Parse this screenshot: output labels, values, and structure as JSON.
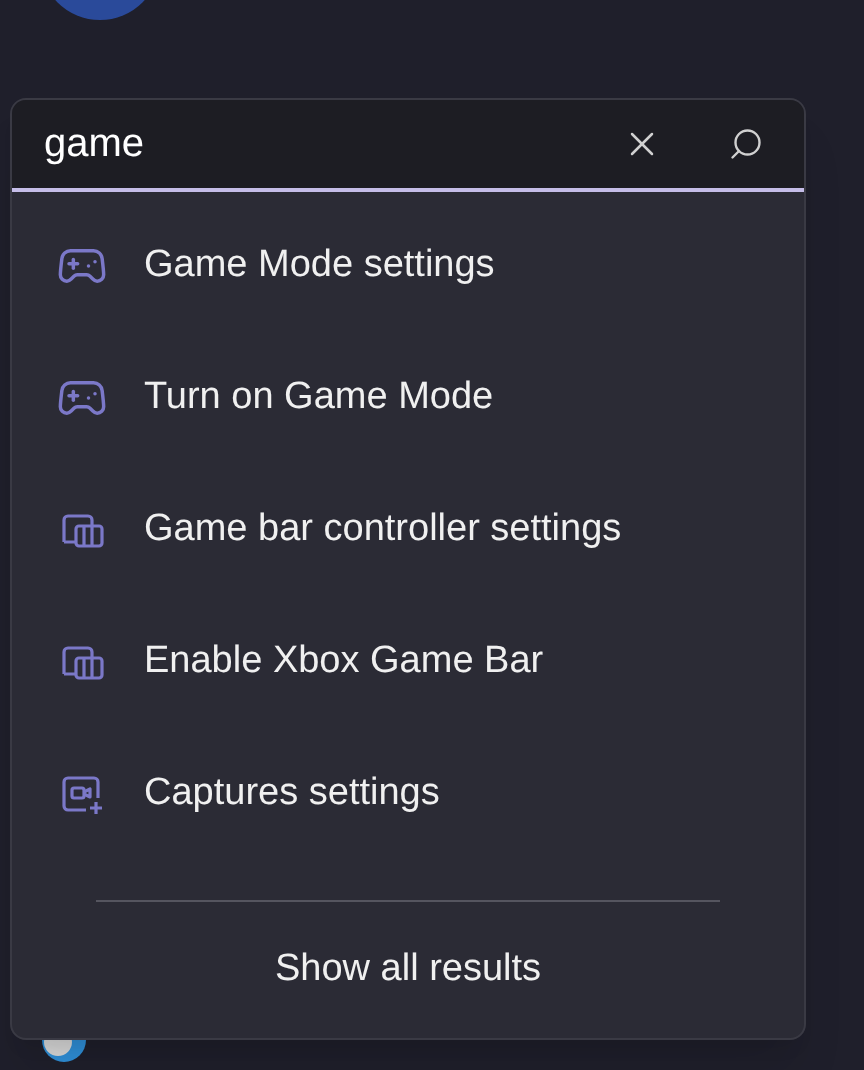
{
  "search": {
    "value": "game"
  },
  "results": [
    {
      "label": "Game Mode settings",
      "kind": "gamepad"
    },
    {
      "label": "Turn on Game Mode",
      "kind": "gamepad"
    },
    {
      "label": "Game bar controller settings",
      "kind": "gamebar"
    },
    {
      "label": "Enable Xbox Game Bar",
      "kind": "gamebar"
    },
    {
      "label": "Captures settings",
      "kind": "capture"
    }
  ],
  "show_all": "Show all results"
}
